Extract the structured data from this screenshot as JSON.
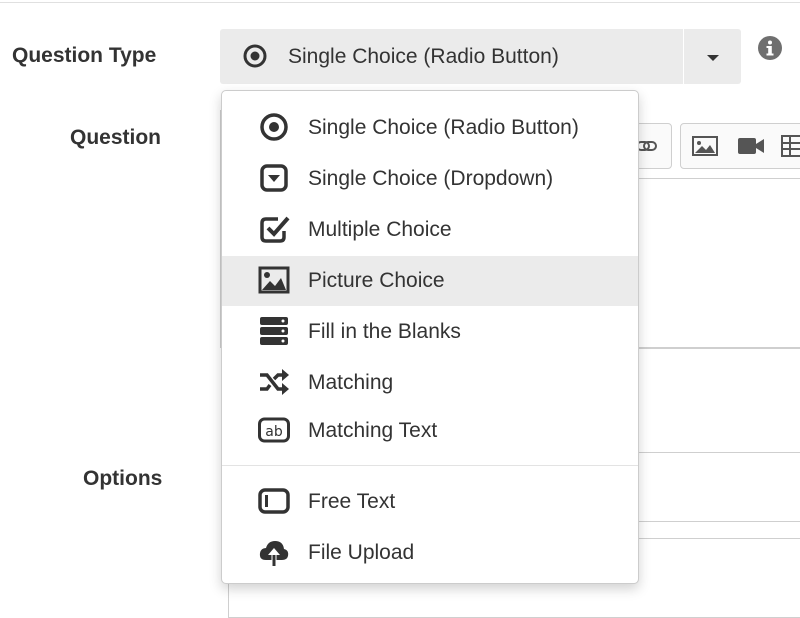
{
  "form": {
    "question_type_label": "Question Type",
    "question_label": "Question",
    "options_label": "Options"
  },
  "question_type_select": {
    "selected_label": "Single Choice (Radio Button)",
    "selected_icon": "radio-button-icon"
  },
  "menu": {
    "items": [
      {
        "label": "Single Choice (Radio Button)",
        "icon": "radio-button-icon"
      },
      {
        "label": "Single Choice (Dropdown)",
        "icon": "dropdown-square-icon"
      },
      {
        "label": "Multiple Choice",
        "icon": "checkbox-icon"
      },
      {
        "label": "Picture Choice",
        "icon": "picture-icon",
        "highlighted": true
      },
      {
        "label": "Fill in the Blanks",
        "icon": "server-stack-icon"
      },
      {
        "label": "Matching",
        "icon": "shuffle-icon"
      },
      {
        "label": "Matching Text",
        "icon": "ab-text-icon"
      },
      {
        "label": "Free Text",
        "icon": "text-field-icon"
      },
      {
        "label": "File Upload",
        "icon": "cloud-upload-icon"
      }
    ]
  },
  "colors": {
    "text": "#333333",
    "select_bg": "#ebebeb",
    "highlight_bg": "#ebebeb",
    "border": "#cccccc"
  }
}
